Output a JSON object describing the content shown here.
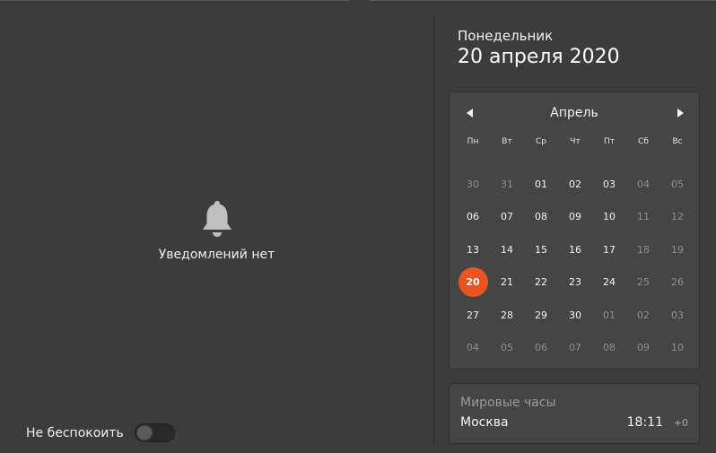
{
  "notifications": {
    "empty_label": "Уведомлений нет",
    "dnd_label": "Не беспокоить",
    "dnd_enabled": false
  },
  "date": {
    "weekday": "Понедельник",
    "full": "20 апреля 2020"
  },
  "calendar": {
    "month": "Апрель",
    "weekdays": [
      "Пн",
      "Вт",
      "Ср",
      "Чт",
      "Пт",
      "Сб",
      "Вс"
    ],
    "weeks": [
      [
        {
          "d": "30",
          "m": true
        },
        {
          "d": "31",
          "m": true
        },
        {
          "d": "01"
        },
        {
          "d": "02"
        },
        {
          "d": "03"
        },
        {
          "d": "04",
          "m": true
        },
        {
          "d": "05",
          "m": true
        }
      ],
      [
        {
          "d": "06"
        },
        {
          "d": "07"
        },
        {
          "d": "08"
        },
        {
          "d": "09"
        },
        {
          "d": "10"
        },
        {
          "d": "11",
          "m": true
        },
        {
          "d": "12",
          "m": true
        }
      ],
      [
        {
          "d": "13"
        },
        {
          "d": "14"
        },
        {
          "d": "15"
        },
        {
          "d": "16"
        },
        {
          "d": "17"
        },
        {
          "d": "18",
          "m": true
        },
        {
          "d": "19",
          "m": true
        }
      ],
      [
        {
          "d": "20",
          "today": true
        },
        {
          "d": "21"
        },
        {
          "d": "22"
        },
        {
          "d": "23"
        },
        {
          "d": "24"
        },
        {
          "d": "25",
          "m": true
        },
        {
          "d": "26",
          "m": true
        }
      ],
      [
        {
          "d": "27"
        },
        {
          "d": "28"
        },
        {
          "d": "29"
        },
        {
          "d": "30"
        },
        {
          "d": "01",
          "m": true
        },
        {
          "d": "02",
          "m": true
        },
        {
          "d": "03",
          "m": true
        }
      ],
      [
        {
          "d": "04",
          "m": true
        },
        {
          "d": "05",
          "m": true
        },
        {
          "d": "06",
          "m": true
        },
        {
          "d": "07",
          "m": true
        },
        {
          "d": "08",
          "m": true
        },
        {
          "d": "09",
          "m": true
        },
        {
          "d": "10",
          "m": true
        }
      ]
    ]
  },
  "world_clocks": {
    "title": "Мировые часы",
    "entries": [
      {
        "city": "Москва",
        "time": "18:11",
        "offset": "+0"
      }
    ]
  },
  "colors": {
    "accent": "#e95420",
    "background": "#3c3c3c",
    "card": "#454545"
  },
  "icons": {
    "empty": "bell-icon",
    "prev": "triangle-left-icon",
    "next": "triangle-right-icon"
  }
}
